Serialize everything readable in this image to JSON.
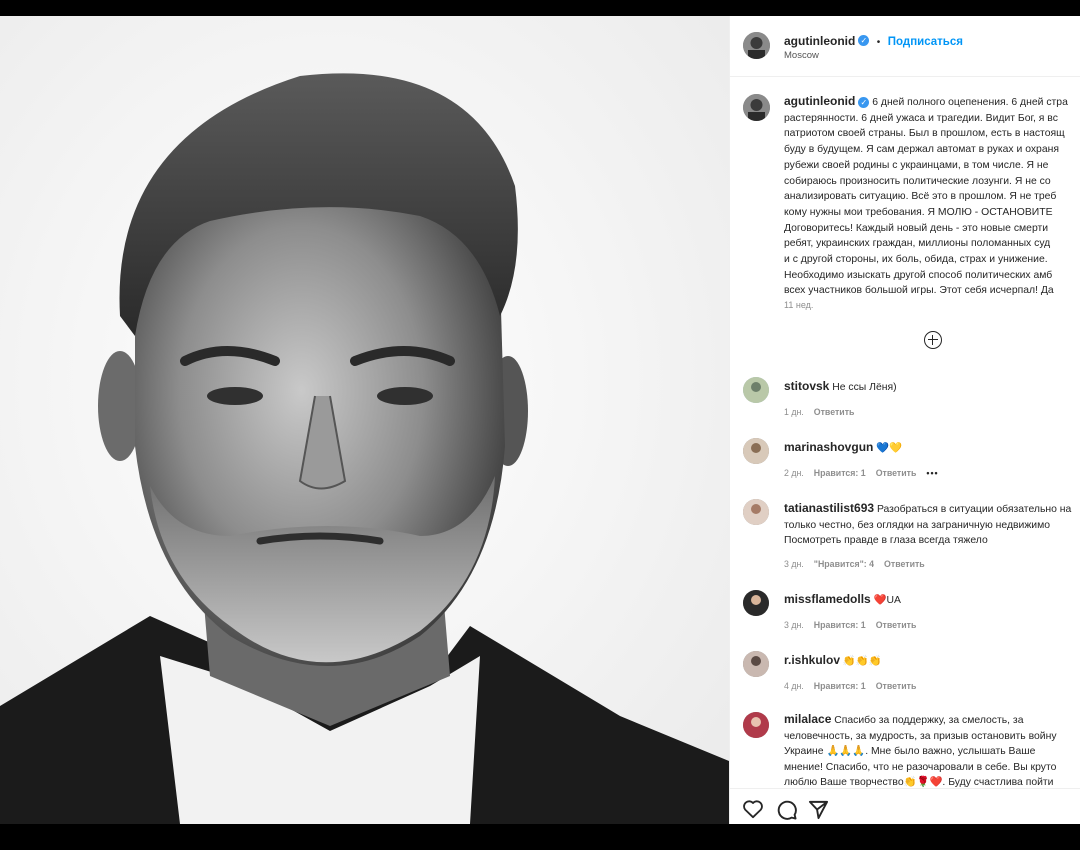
{
  "post": {
    "username": "agutinleonid",
    "verified_mark": "✓",
    "separator": "•",
    "follow_label": "Подписаться",
    "location": "Moscow",
    "caption_lines": [
      "6 дней полного оцепенения. 6 дней стра",
      "растерянности. 6 дней ужаса и трагедии. Видит Бог, я вс",
      "патриотом своей страны. Был в прошлом, есть в настоящ",
      "буду в будущем. Я сам держал автомат в руках и охраня",
      "рубежи своей родины с украинцами, в том числе. Я не",
      "собираюсь произносить политические лозунги. Я не со",
      "анализировать ситуацию. Всё это в прошлом. Я не треб",
      "кому нужны мои требования. Я МОЛЮ - ОСТАНОВИТЕ",
      "Договоритесь! Каждый новый день - это новые смерти",
      "ребят, украинских граждан, миллионы поломанных суд",
      "и с другой стороны, их боль, обида, страх и унижение.",
      "Необходимо изыскать другой способ политических амб",
      "всех участников большой игры. Этот себя исчерпал! Да"
    ],
    "time_ago": "11 нед."
  },
  "comments": [
    {
      "username": "stitovsk",
      "text_lines": [
        "Не ссы Лёня)"
      ],
      "time": "1 дн.",
      "likes": "",
      "reply": "Ответить",
      "more": ""
    },
    {
      "username": "marinashovgun",
      "text_lines": [
        "💙💛"
      ],
      "time": "2 дн.",
      "likes": "Нравится: 1",
      "reply": "Ответить",
      "more": "•••"
    },
    {
      "username": "tatianastilist693",
      "text_lines": [
        "Разобраться в ситуации обязательно на",
        "только честно, без оглядки на заграничную недвижимо",
        "Посмотреть правде в глаза всегда тяжело"
      ],
      "time": "3 дн.",
      "likes": "\"Нравится\": 4",
      "reply": "Ответить",
      "more": ""
    },
    {
      "username": "missflamedolls",
      "text_lines": [
        "❤️UA"
      ],
      "time": "3 дн.",
      "likes": "Нравится: 1",
      "reply": "Ответить",
      "more": ""
    },
    {
      "username": "r.ishkulov",
      "text_lines": [
        "👏👏👏"
      ],
      "time": "4 дн.",
      "likes": "Нравится: 1",
      "reply": "Ответить",
      "more": ""
    },
    {
      "username": "milalace",
      "text_lines": [
        "Спасибо за поддержку, за смелость, за",
        "человечность, за мудрость, за призыв остановить войну",
        "Украине 🙏🙏🙏. Мне было важно, услышать Ваше",
        "мнение! Спасибо, что не разочаровали в себе. Вы круто",
        "люблю Ваше творчество👏🌹❤️. Буду счастлива пойти"
      ],
      "time": "",
      "likes": "",
      "reply": "",
      "more": ""
    }
  ],
  "actions": {
    "like": "heart-icon",
    "comment": "comment-icon",
    "share": "share-icon"
  }
}
